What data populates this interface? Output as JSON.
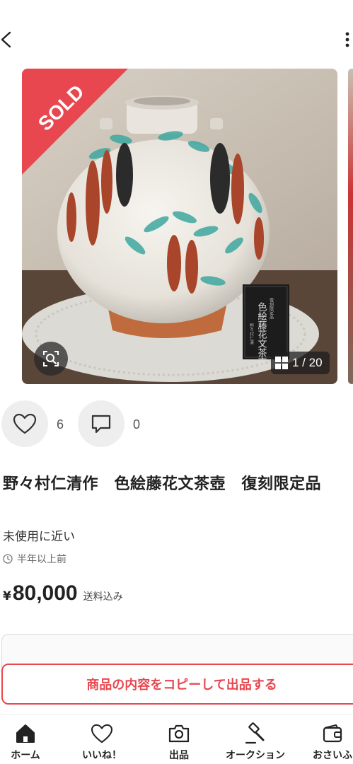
{
  "header": {
    "back_icon": "chevron-left-icon",
    "more_icon": "vertical-dots-icon"
  },
  "gallery": {
    "sold_label": "SOLD",
    "counter": "1 / 20",
    "box_label_top": "復刻限定品",
    "box_label_main": "色絵藤花文茶壺",
    "box_label_side": "野々村仁清",
    "colors": {
      "sold_red": "#e8474f"
    }
  },
  "actions": {
    "like_count": "6",
    "comment_count": "0"
  },
  "item": {
    "title": "野々村仁清作　色絵藤花文茶壺　復刻限定品",
    "condition": "未使用に近い",
    "posted": "半年以上前",
    "price_yen": "¥",
    "price_amount": "80,000",
    "shipping": "送料込み"
  },
  "copy_button": {
    "label": "商品の内容をコピーして出品する"
  },
  "tabbar": {
    "items": [
      {
        "label": "ホーム",
        "icon": "home-icon"
      },
      {
        "label": "いいね！",
        "icon": "heart-icon"
      },
      {
        "label": "出品",
        "icon": "camera-icon"
      },
      {
        "label": "オークション",
        "icon": "gavel-icon"
      },
      {
        "label": "おさいふ",
        "icon": "wallet-icon"
      }
    ]
  }
}
